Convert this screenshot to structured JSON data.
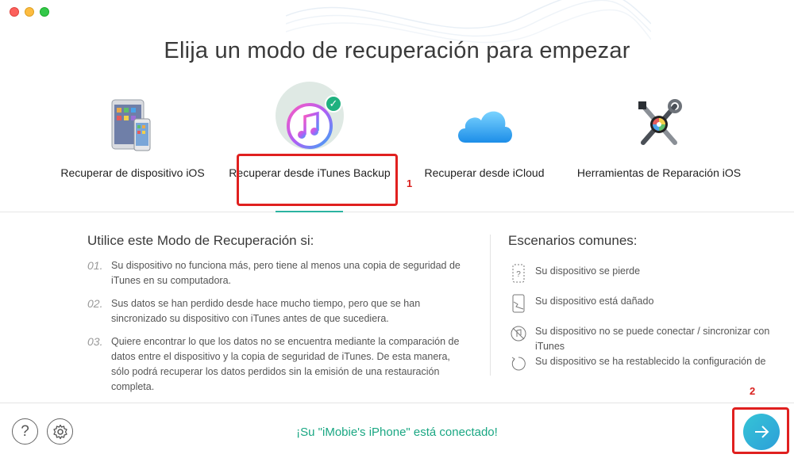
{
  "title": "Elija un modo de recuperación para empezar",
  "modes": [
    {
      "label": "Recuperar de dispositivo iOS",
      "icon": "ios-devices-icon"
    },
    {
      "label": "Recuperar desde iTunes Backup",
      "icon": "itunes-icon"
    },
    {
      "label": "Recuperar desde iCloud",
      "icon": "icloud-icon"
    },
    {
      "label": "Herramientas de Reparación iOS",
      "icon": "repair-tools-icon"
    }
  ],
  "annotations": {
    "first": "1",
    "second": "2"
  },
  "usage": {
    "heading": "Utilice este Modo de Recuperación si:",
    "items": [
      {
        "num": "01.",
        "text": "Su dispositivo no funciona más, pero tiene al menos una copia de seguridad de iTunes en su computadora."
      },
      {
        "num": "02.",
        "text": "Sus datos se han perdido desde hace mucho tiempo, pero que se han sincronizado su dispositivo con iTunes antes de que sucediera."
      },
      {
        "num": "03.",
        "text": "Quiere encontrar lo que los datos no se encuentra mediante la comparación de datos entre el dispositivo y la copia de seguridad de iTunes. De esta manera, sólo podrá recuperar los datos perdidos sin la emisión de una restauración completa."
      }
    ]
  },
  "scenarios": {
    "heading": "Escenarios comunes:",
    "items": [
      {
        "icon": "lost-device-icon",
        "text": "Su dispositivo se pierde"
      },
      {
        "icon": "damaged-device-icon",
        "text": "Su dispositivo está dañado"
      },
      {
        "icon": "no-sync-icon",
        "text": "Su dispositivo no se puede conectar / sincronizar con iTunes"
      },
      {
        "icon": "restore-icon",
        "text": "Su dispositivo se ha restablecido la configuración de"
      }
    ]
  },
  "footer": {
    "status": "¡Su \"iMobie's iPhone\" está conectado!",
    "help_glyph": "?",
    "settings_icon": "gear-icon",
    "next_icon": "arrow-right-icon"
  },
  "colors": {
    "accent": "#1aa783",
    "highlight": "#e0201f",
    "next": "#2d9fd9"
  }
}
